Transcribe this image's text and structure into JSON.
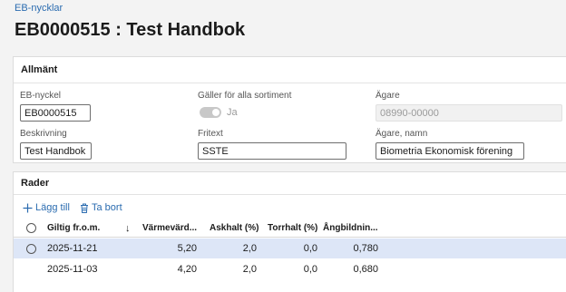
{
  "breadcrumb": "EB-nycklar",
  "title": "EB0000515 : Test Handbok",
  "general": {
    "section_title": "Allmänt",
    "eb_key": {
      "label": "EB-nyckel",
      "value": "EB0000515"
    },
    "applies_all": {
      "label": "Gäller för alla sortiment",
      "value_text": "Ja",
      "on": true
    },
    "owner": {
      "label": "Ägare",
      "value": "08990-00000"
    },
    "description": {
      "label": "Beskrivning",
      "value": "Test Handbok"
    },
    "free_text": {
      "label": "Fritext",
      "value": "SSTE"
    },
    "owner_name": {
      "label": "Ägare, namn",
      "value": "Biometria Ekonomisk förening"
    }
  },
  "rows_section": {
    "section_title": "Rader",
    "add_label": "Lägg till",
    "delete_label": "Ta bort",
    "columns": [
      "Giltig fr.o.m.",
      "Värmevärd...",
      "Askhalt (%)",
      "Torrhalt (%)",
      "Ångbildnin..."
    ],
    "sort_indicator": "↓",
    "rows": [
      {
        "date": "2025-11-21",
        "heat": "5,20",
        "ash": "2,0",
        "dry": "0,0",
        "steam": "0,780",
        "selected": true
      },
      {
        "date": "2025-11-03",
        "heat": "4,20",
        "ash": "2,0",
        "dry": "0,0",
        "steam": "0,680",
        "selected": false
      }
    ]
  },
  "colors": {
    "accent": "#2b6cb0",
    "selected_row": "#dde6f7"
  },
  "icons": {
    "add": "plus-icon",
    "delete": "trash-icon",
    "sort": "arrow-down-icon",
    "select": "radio-icon"
  }
}
